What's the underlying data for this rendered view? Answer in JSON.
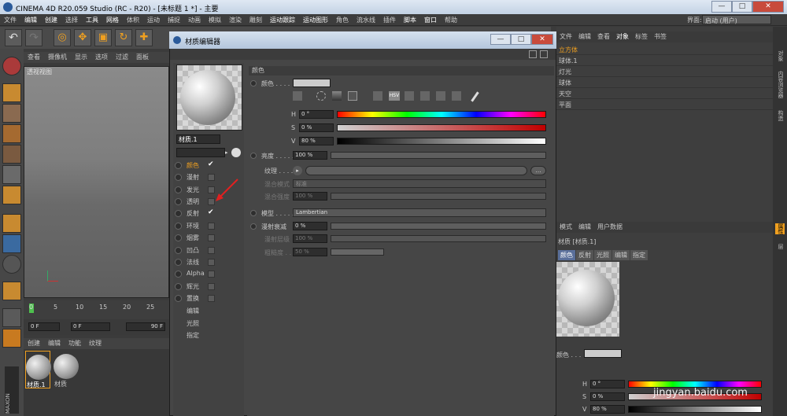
{
  "window": {
    "title": "CINEMA 4D R20.059 Studio (RC - R20) - [未标题 1 *] - 主要"
  },
  "menubar": [
    "文件",
    "编辑",
    "创建",
    "选择",
    "工具",
    "网格",
    "体积",
    "运动",
    "捕捉",
    "动画",
    "模拟",
    "渲染",
    "雕刻",
    "运动跟踪",
    "运动图形",
    "角色",
    "流水线",
    "插件",
    "脚本",
    "窗口",
    "帮助"
  ],
  "layout": {
    "label": "界面:",
    "value": "启动 (用户)"
  },
  "viewport": {
    "menu": [
      "查看",
      "摄像机",
      "显示",
      "选项",
      "过滤",
      "面板"
    ],
    "label": "透视视图"
  },
  "timeline": {
    "ticks": [
      "0",
      "5",
      "10",
      "15",
      "20",
      "25"
    ],
    "start": "0 F",
    "field1": "0 F",
    "end": "90 F"
  },
  "material_manager": {
    "menu": [
      "创建",
      "编辑",
      "功能",
      "纹理"
    ],
    "items": [
      "材质.1",
      "材质"
    ]
  },
  "dialog": {
    "title": "材质编辑器",
    "material_name": "材质.1",
    "channels": [
      {
        "label": "颜色",
        "checked": true,
        "active": true
      },
      {
        "label": "漫射",
        "checked": false
      },
      {
        "label": "发光",
        "checked": false
      },
      {
        "label": "透明",
        "checked": false
      },
      {
        "label": "反射",
        "checked": true
      },
      {
        "label": "环境",
        "checked": false
      },
      {
        "label": "烟雾",
        "checked": false
      },
      {
        "label": "凹凸",
        "checked": false
      },
      {
        "label": "法线",
        "checked": false
      },
      {
        "label": "Alpha",
        "checked": false
      },
      {
        "label": "辉光",
        "checked": false
      },
      {
        "label": "置换",
        "checked": false
      }
    ],
    "extra": [
      "编辑",
      "光照",
      "指定"
    ],
    "section_color": "颜色",
    "color_label": "颜色 . . . .",
    "hsv": "HSV",
    "h_label": "H",
    "h_value": "0 °",
    "s_label": "S",
    "s_value": "0 %",
    "v_label": "V",
    "v_value": "80 %",
    "brightness_label": "亮度 . . . . .",
    "brightness_value": "100 %",
    "texture_label": "纹理 . . . . .",
    "texture_btn": "...",
    "blend_mode_label": "混合模式",
    "blend_mode_value": "标准",
    "blend_strength_label": "混合强度",
    "blend_strength_value": "100 %",
    "model_label": "模型 . . . . .",
    "model_value": "Lambertian",
    "diffuse_falloff_label": "漫射衰减",
    "diffuse_falloff_value": "0 %",
    "diffuse_level_label": "漫射层级",
    "diffuse_level_value": "100 %",
    "roughness_label": "粗糙度 . . .",
    "roughness_value": "50 %"
  },
  "object_manager": {
    "menu": [
      "文件",
      "编辑",
      "查看",
      "对象",
      "标签",
      "书签"
    ],
    "objects": [
      {
        "name": "立方体",
        "selected": true
      },
      {
        "name": "球体.1",
        "selected": false
      },
      {
        "name": "灯光",
        "selected": false
      },
      {
        "name": "球体",
        "selected": false
      },
      {
        "name": "天空",
        "selected": false
      },
      {
        "name": "平面",
        "selected": false
      }
    ]
  },
  "attributes": {
    "menu": [
      "模式",
      "编辑",
      "用户数据"
    ],
    "title": "材质 [材质.1]",
    "channels": [
      "颜色",
      "反射",
      "光照",
      "编辑",
      "指定"
    ],
    "color_label": "颜色 . . .",
    "h_label": "H",
    "h_value": "0 °",
    "s_label": "S",
    "s_value": "0 %",
    "v_label": "V",
    "v_value": "80 %"
  },
  "side_tabs": [
    "对象",
    "内容浏览器",
    "构造",
    "属性",
    "层"
  ],
  "watermark": "jingyan.baidu.com",
  "colors": {
    "accent": "#f0a020",
    "panel": "#464646",
    "selected_tab": "#5a6f9a"
  }
}
